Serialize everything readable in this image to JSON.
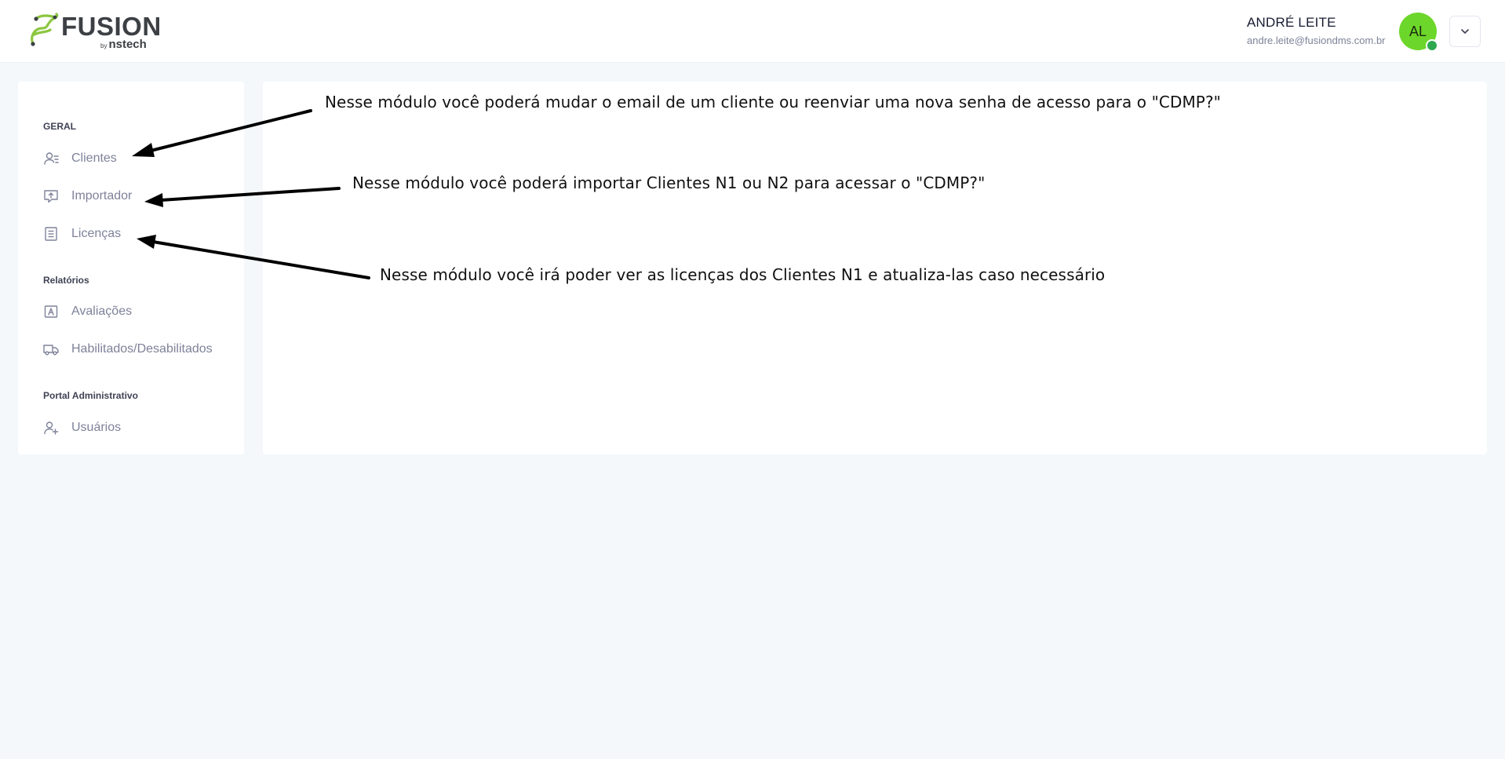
{
  "header": {
    "logo_text": "FUSION",
    "logo_by": "by",
    "logo_brand": "nstech",
    "user_name": "ANDRÉ LEITE",
    "user_email": "andre.leite@fusiondms.com.br",
    "avatar_initials": "AL",
    "avatar_color": "#6dd62a",
    "status_color": "#2ea84f"
  },
  "sidebar": {
    "sections": [
      {
        "title": "GERAL",
        "items": [
          {
            "label": "Clientes",
            "icon": "clients-icon"
          },
          {
            "label": "Importador",
            "icon": "upload-icon"
          },
          {
            "label": "Licenças",
            "icon": "document-icon"
          }
        ]
      },
      {
        "title": "Relatórios",
        "items": [
          {
            "label": "Avaliações",
            "icon": "rating-icon"
          },
          {
            "label": "Habilitados/Desabilitados",
            "icon": "truck-icon"
          }
        ]
      },
      {
        "title": "Portal Administrativo",
        "items": [
          {
            "label": "Usuários",
            "icon": "add-user-icon"
          }
        ]
      }
    ]
  },
  "annotations": [
    "Nesse módulo você poderá mudar o email de um cliente ou reenviar uma nova senha de acesso para o \"CDMP?\"",
    "Nesse módulo você poderá importar Clientes N1 ou N2 para acessar o \"CDMP?\"",
    "Nesse módulo você irá poder ver as licenças dos Clientes N1 e atualiza-las caso necessário"
  ]
}
